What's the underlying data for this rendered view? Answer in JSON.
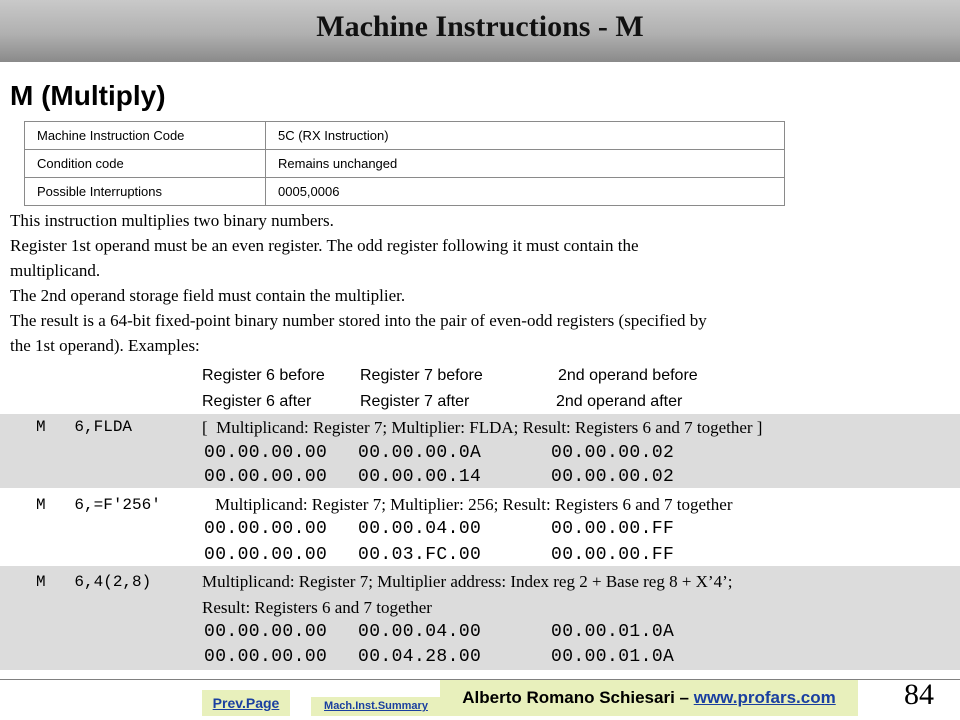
{
  "header": {
    "title": "Machine Instructions - M"
  },
  "section": {
    "heading": "M (Multiply)"
  },
  "info_table": [
    {
      "label": "Machine Instruction Code",
      "value": "5C (RX Instruction)"
    },
    {
      "label": "Condition code",
      "value": "Remains unchanged"
    },
    {
      "label": "Possible Interruptions",
      "value": "0005,0006"
    }
  ],
  "description": {
    "line1": "This instruction multiplies two binary numbers.",
    "line2": "Register 1st operand must be an even register. The odd register following it must contain the",
    "line3": "multiplicand.",
    "line4": "The 2nd operand storage field must contain the multiplier.",
    "line5": "The result is a 64-bit fixed-point binary number stored into the pair of even-odd registers (specified by",
    "line6": "the 1st operand). Examples:"
  },
  "column_labels": {
    "r6_before": "Register 6  before",
    "r7_before": "Register 7 before",
    "op2_before": "2nd operand before",
    "r6_after": "Register 6  after",
    "r7_after": "Register 7 after",
    "op2_after": "2nd operand after"
  },
  "examples": [
    {
      "instruction": "M   6,FLDA",
      "comment": "[  Multiplicand: Register 7; Multiplier: FLDA; Result: Registers 6 and 7 together ]",
      "before": [
        "00.00.00.00",
        "00.00.00.0A",
        "00.00.00.02"
      ],
      "after": [
        "00.00.00.00",
        "00.00.00.14",
        "00.00.00.02"
      ]
    },
    {
      "instruction": "M   6,=F'256'",
      "comment": "Multiplicand: Register 7; Multiplier: 256; Result: Registers 6 and 7 together",
      "before": [
        "00.00.00.00",
        "00.00.04.00",
        "00.00.00.FF"
      ],
      "after": [
        "00.00.00.00",
        "00.03.FC.00",
        "00.00.00.FF"
      ]
    },
    {
      "instruction": "M   6,4(2,8)",
      "comment": "Multiplicand: Register 7; Multiplier address: Index reg 2 + Base reg 8 + X’4’;",
      "comment2": "Result: Registers 6 and 7 together",
      "before": [
        "00.00.00.00",
        "00.00.04.00",
        "00.00.01.0A"
      ],
      "after": [
        "00.00.00.00",
        "00.04.28.00",
        "00.00.01.0A"
      ]
    }
  ],
  "footer": {
    "prev_page": "Prev.Page",
    "summary": "Mach.Inst.Summary",
    "author": "Alberto Romano Schiesari –",
    "website": "www.profars.com",
    "page_number": "84"
  }
}
